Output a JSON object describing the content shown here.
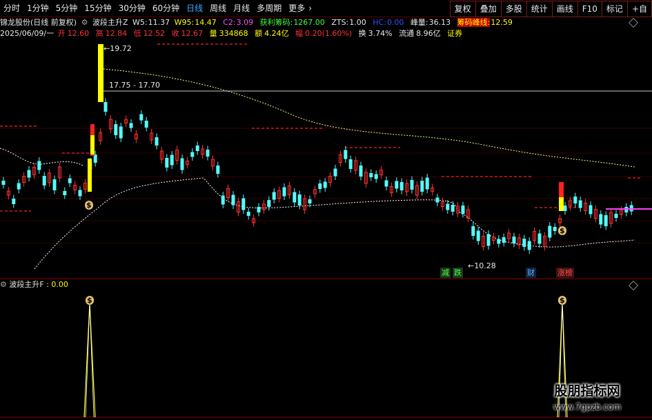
{
  "toolbar": {
    "tabs": [
      "分时",
      "1分钟",
      "5分钟",
      "15分钟",
      "30分钟",
      "60分钟",
      "日线",
      "周线",
      "月线",
      "多周期",
      "更多"
    ],
    "active_tab": "日线",
    "more_chevron": "›",
    "right_buttons": [
      "复权",
      "叠加",
      "多股",
      "统计",
      "画线",
      "F10",
      "标记",
      "+自"
    ]
  },
  "info_line1": {
    "stock": "锦龙股份(日线 前复权)",
    "indicator": "波段主升Z",
    "w5_label": "W5:",
    "w5": "11.37",
    "w95_label": "W95:",
    "w95": "14.47",
    "c2_label": "C2:",
    "c2": "3.09",
    "profit_label": "获利筹码:",
    "profit": "1267.00",
    "zts_label": "ZTS:",
    "zts": "1.00",
    "hc_label": "HC:",
    "hc": "0.00",
    "peak_label": "峰量:",
    "peak": "36.13",
    "chip_label": "筹码峰线:",
    "chip": "12.59"
  },
  "info_line2": {
    "date": "2025/06/09/一",
    "open_label": "开",
    "open": "12.60",
    "high_label": "高",
    "high": "12.84",
    "low_label": "低",
    "low": "12.52",
    "close_label": "收",
    "close": "12.67",
    "vol_label": "量",
    "vol": "334868",
    "amount_label": "额",
    "amount": "4.24亿",
    "range_label": "幅",
    "range": "0.20(1.60%)",
    "turnover_label": "换",
    "turnover": "3.74%",
    "float_label": "流通",
    "float": "8.96亿",
    "sector": "证券"
  },
  "annotations": {
    "high_price": "19.72",
    "range_label": "17.75 - 17.70",
    "low_price": "10.28",
    "low_arrow": "←",
    "high_arrow": "←",
    "tag_reduce": "减",
    "tag_fall": "跌",
    "tag_finance": "财",
    "tag_limit": "涨榜",
    "money_glyph": "$"
  },
  "sub_panel": {
    "label": "波段主升F :",
    "value": "0.00"
  },
  "watermark": {
    "title": "股朋指标网",
    "url": "www.7gpzb.com"
  },
  "colors": {
    "up": "#ff3232",
    "down": "#54fcfc",
    "accent_blue": "#40a8ff",
    "yellow": "#ffff00",
    "grid": "#5a0000"
  }
}
